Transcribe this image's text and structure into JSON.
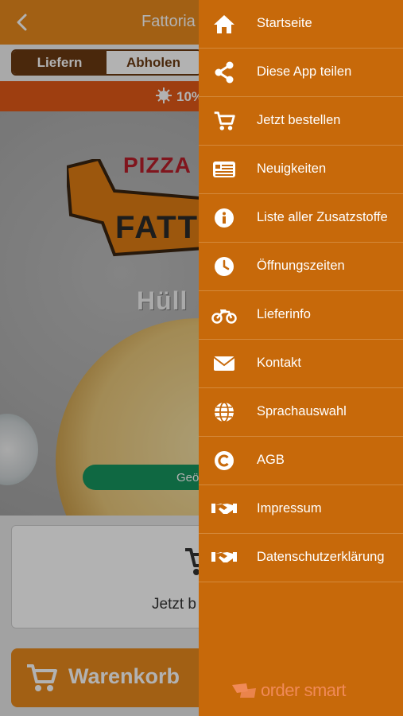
{
  "header": {
    "title": "Fattoria"
  },
  "mode_switch": {
    "active": "Liefern",
    "inactive": "Abholen"
  },
  "promo": {
    "text": "10%"
  },
  "hero": {
    "logo_line1": "PIZZA",
    "logo_line2": "FATT",
    "logo_line3": "Hüll",
    "status_button": "Geö"
  },
  "order_card": {
    "text": "Jetzt b"
  },
  "cart_button": {
    "label": "Warenkorb"
  },
  "menu": {
    "items": [
      {
        "label": "Startseite",
        "icon": "home-icon"
      },
      {
        "label": "Diese App teilen",
        "icon": "share-icon"
      },
      {
        "label": "Jetzt bestellen",
        "icon": "cart-icon"
      },
      {
        "label": "Neuigkeiten",
        "icon": "news-icon"
      },
      {
        "label": "Liste aller Zusatzstoffe",
        "icon": "info-icon"
      },
      {
        "label": "Öffnungszeiten",
        "icon": "clock-icon"
      },
      {
        "label": "Lieferinfo",
        "icon": "motorcycle-icon"
      },
      {
        "label": "Kontakt",
        "icon": "envelope-icon"
      },
      {
        "label": "Sprachauswahl",
        "icon": "globe-icon"
      },
      {
        "label": "AGB",
        "icon": "copyright-icon"
      },
      {
        "label": "Impressum",
        "icon": "handshake-icon"
      },
      {
        "label": "Datenschutzerklärung",
        "icon": "handshake-icon"
      }
    ]
  },
  "footer": {
    "brand": "order smart"
  },
  "colors": {
    "drawer": "#c7690a",
    "header": "#e98a1d",
    "promo": "#e25a17",
    "brand_accent": "#f08a58"
  }
}
